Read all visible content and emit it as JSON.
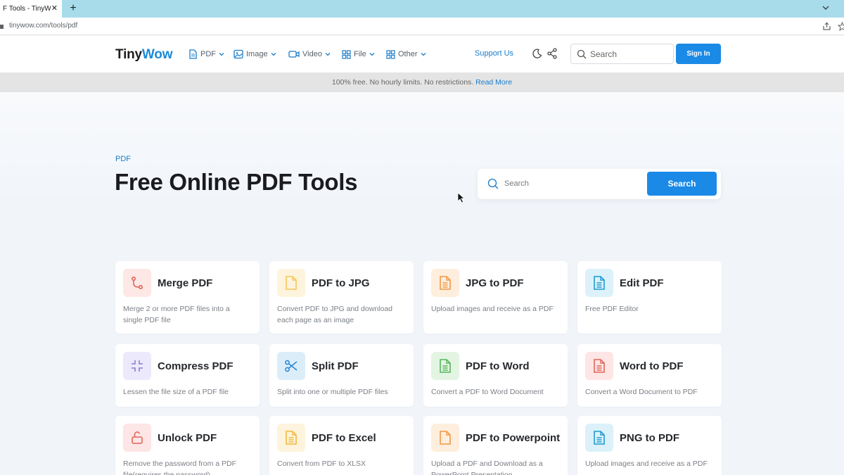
{
  "browser": {
    "tab_title": "F Tools - TinyWow",
    "tab_close": "✕",
    "new_tab": "+",
    "url": "tinywow.com/tools/pdf"
  },
  "header": {
    "logo_main": "Tiny",
    "logo_accent": "Wow",
    "nav": [
      {
        "label": "PDF",
        "icon": "pdf-icon"
      },
      {
        "label": "Image",
        "icon": "image-icon"
      },
      {
        "label": "Video",
        "icon": "video-icon"
      },
      {
        "label": "File",
        "icon": "file-icon"
      },
      {
        "label": "Other",
        "icon": "other-icon"
      }
    ],
    "support": "Support Us",
    "search_placeholder": "Search",
    "signin": "Sign In"
  },
  "notice": {
    "text": "100% free. No hourly limits. No restrictions.",
    "link": "Read More"
  },
  "hero": {
    "crumb": "PDF",
    "title": "Free Online PDF Tools",
    "search_placeholder": "Search",
    "search_button": "Search"
  },
  "colors": {
    "accent": "#1a8ae6",
    "logo_accent": "#1a8ad8"
  },
  "tools": [
    {
      "title": "Merge PDF",
      "desc": "Merge 2 or more PDF files into a single PDF file",
      "icon": "merge-icon",
      "bg": "#fde8e6",
      "fg": "#e0645a"
    },
    {
      "title": "PDF to JPG",
      "desc": "Convert PDF to JPG and download each page as an image",
      "icon": "document-icon",
      "bg": "#fef3dc",
      "fg": "#f3c65c"
    },
    {
      "title": "JPG to PDF",
      "desc": "Upload images and receive as a PDF",
      "icon": "document-lines-icon",
      "bg": "#feeedd",
      "fg": "#ef9a45"
    },
    {
      "title": "Edit PDF",
      "desc": "Free PDF Editor",
      "icon": "document-lines-icon",
      "bg": "#dcf1fa",
      "fg": "#1f9bd0"
    },
    {
      "title": "Compress PDF",
      "desc": "Lessen the file size of a PDF file",
      "icon": "compress-icon",
      "bg": "#ebe9fb",
      "fg": "#8a80cf"
    },
    {
      "title": "Split PDF",
      "desc": "Split into one or multiple PDF files",
      "icon": "scissors-icon",
      "bg": "#dcedfa",
      "fg": "#2a8ad6"
    },
    {
      "title": "PDF to Word",
      "desc": "Convert a PDF to Word Document",
      "icon": "document-lines-icon",
      "bg": "#e3f5e2",
      "fg": "#56b45c"
    },
    {
      "title": "Word to PDF",
      "desc": "Convert a Word Document to PDF",
      "icon": "document-lines-icon",
      "bg": "#fde6e5",
      "fg": "#e0645a"
    },
    {
      "title": "Unlock PDF",
      "desc": "Remove the password from a PDF file(requires the password)",
      "icon": "unlock-icon",
      "bg": "#fde6e5",
      "fg": "#e0645a"
    },
    {
      "title": "PDF to Excel",
      "desc": "Convert from PDF to XLSX",
      "icon": "document-lines-icon",
      "bg": "#fef3dc",
      "fg": "#f1b93e"
    },
    {
      "title": "PDF to Powerpoint",
      "desc": "Upload a PDF and Download as a PowerPoint Presentation",
      "icon": "document-icon",
      "bg": "#feeedd",
      "fg": "#ef9a45"
    },
    {
      "title": "PNG to PDF",
      "desc": "Upload images and receive as a PDF",
      "icon": "document-lines-icon",
      "bg": "#dcf1fa",
      "fg": "#1f9bd0"
    }
  ]
}
